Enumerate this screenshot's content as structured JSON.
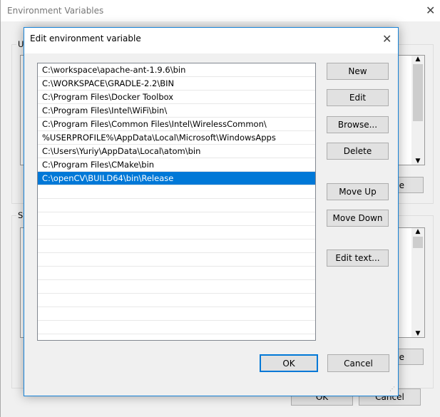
{
  "background_window": {
    "title": "Environment Variables",
    "group1_label": "U",
    "group2_label": "Sy",
    "partial_button_1": "e",
    "partial_button_2": "e",
    "ok": "OK",
    "cancel": "Cancel"
  },
  "dialog": {
    "title": "Edit environment variable",
    "entries": [
      "C:\\workspace\\apache-ant-1.9.6\\bin",
      "C:\\WORKSPACE\\GRADLE-2.2\\BIN",
      "C:\\Program Files\\Docker Toolbox",
      "C:\\Program Files\\Intel\\WiFi\\bin\\",
      "C:\\Program Files\\Common Files\\Intel\\WirelessCommon\\",
      "%USERPROFILE%\\AppData\\Local\\Microsoft\\WindowsApps",
      "C:\\Users\\Yuriy\\AppData\\Local\\atom\\bin",
      "C:\\Program Files\\CMake\\bin",
      "C:\\openCV\\BUILD64\\bin\\Release"
    ],
    "selected_index": 8,
    "buttons": {
      "new": "New",
      "edit": "Edit",
      "browse": "Browse...",
      "delete": "Delete",
      "move_up": "Move Up",
      "move_down": "Move Down",
      "edit_text": "Edit text...",
      "ok": "OK",
      "cancel": "Cancel"
    }
  },
  "colors": {
    "accent": "#0078d7",
    "border": "#1883d7"
  }
}
